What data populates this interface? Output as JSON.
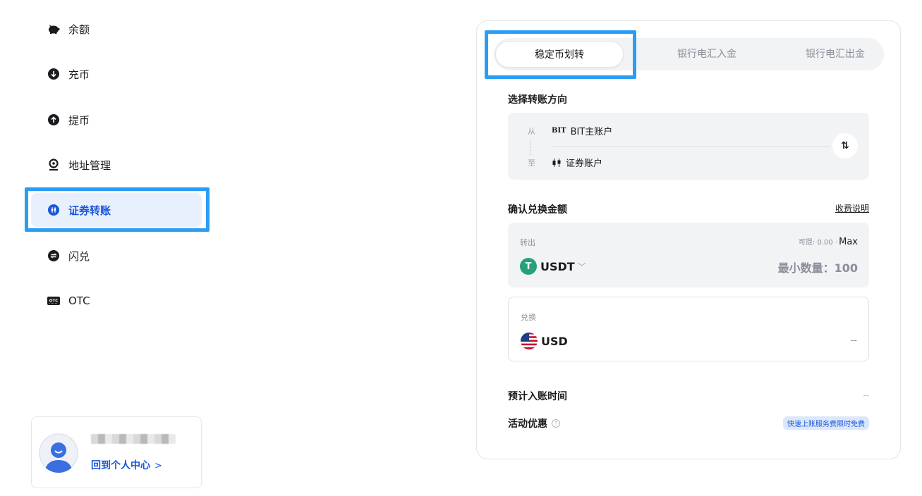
{
  "sidebar": {
    "items": [
      {
        "label": "余额",
        "icon": "piggy-bank-icon"
      },
      {
        "label": "充币",
        "icon": "deposit-icon"
      },
      {
        "label": "提币",
        "icon": "withdraw-icon"
      },
      {
        "label": "地址管理",
        "icon": "location-pin-icon"
      },
      {
        "label": "证券转账",
        "icon": "stock-transfer-icon",
        "active": true
      },
      {
        "label": "闪兑",
        "icon": "flash-swap-icon"
      },
      {
        "label": "OTC",
        "icon": "otc-icon"
      }
    ],
    "user_card": {
      "link_label": "回到个人中心",
      "link_arrow": ">"
    }
  },
  "panel": {
    "tabs": [
      "稳定币划转",
      "银行电汇入金",
      "银行电汇出金"
    ],
    "direction": {
      "title": "选择转账方向",
      "from_label": "从",
      "from_value": "BIT主账户",
      "from_logo": "BIT",
      "to_label": "至",
      "to_value": "证券账户",
      "swap_glyph": "⇅"
    },
    "amount": {
      "title": "确认兑换金额",
      "fee_link": "收费说明",
      "out_label": "转出",
      "available": "可提: 0.00 ·",
      "max_label": "Max",
      "out_coin": "USDT",
      "min_amount": "最小数量：100",
      "in_label": "兑换",
      "in_coin": "USD",
      "in_value": "--"
    },
    "eta": {
      "label": "预计入账时间",
      "value": "--"
    },
    "promo": {
      "label": "活动优惠",
      "badge": "快速上账服务费限时免费"
    }
  },
  "colors": {
    "accent": "#1a56db",
    "highlight": "#2a9df4",
    "tether": "#26a17b"
  }
}
